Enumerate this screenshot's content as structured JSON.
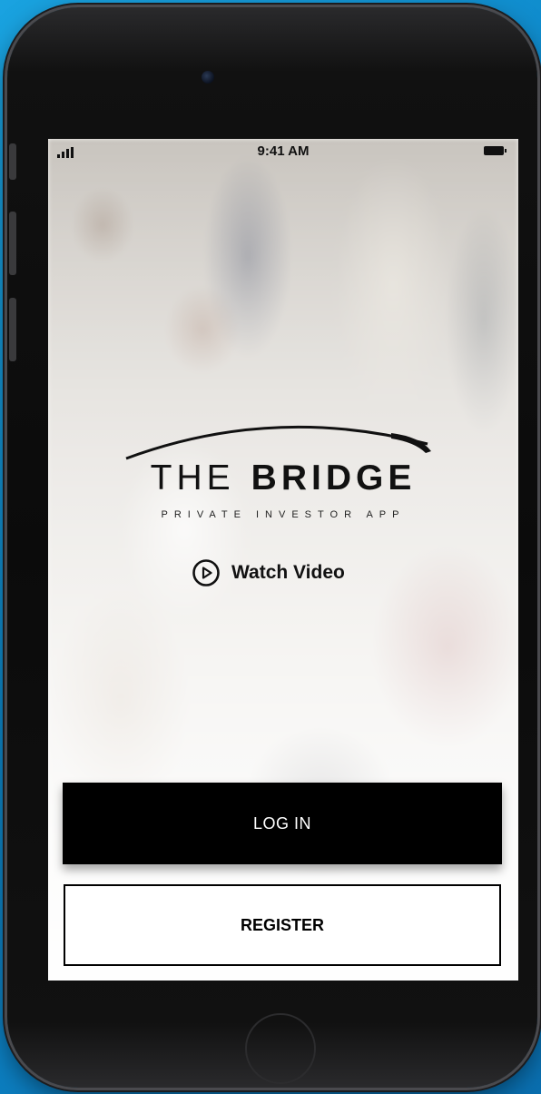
{
  "status_bar": {
    "time": "9:41 AM"
  },
  "logo": {
    "title_light": "THE",
    "title_bold": "BRIDGE",
    "tagline": "PRIVATE INVESTOR APP"
  },
  "watch_video": {
    "label": "Watch Video",
    "icon": "play-circle-icon"
  },
  "buttons": {
    "login_label": "LOG IN",
    "register_label": "REGISTER"
  },
  "colors": {
    "background": "#1aa3e0",
    "primary": "#000000",
    "text_light": "#ffffff"
  }
}
